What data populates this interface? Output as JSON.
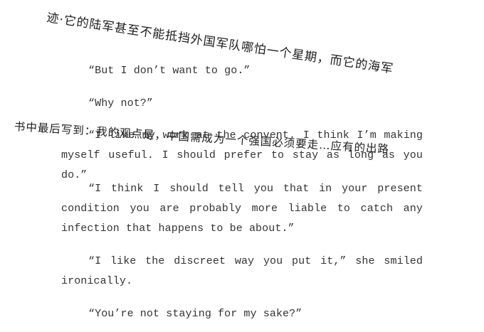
{
  "document": {
    "paragraphs": [
      "“But I don’t want to go.”",
      "“Why not?”",
      "“I like my work at the convent. I think I’m making myself useful. I should prefer to stay as long as you do.”",
      "“I think I should tell you that in your present condition you are probably more liable to catch any infection that happens to be about.”",
      "“I like the discreet way you put it,” she smiled ironically.",
      "“You’re not staying for my sake?”"
    ]
  },
  "annotations": {
    "line1": "迹·它的陆军甚至不能抵挡外国军队哪怕一个星期，而它的海军",
    "line2": "书中最后写到：我的观点是，中国需成为一个强国必须要走…应有的出路"
  },
  "colors": {
    "text": "#333333",
    "handwriting": "#1d1d1d"
  }
}
